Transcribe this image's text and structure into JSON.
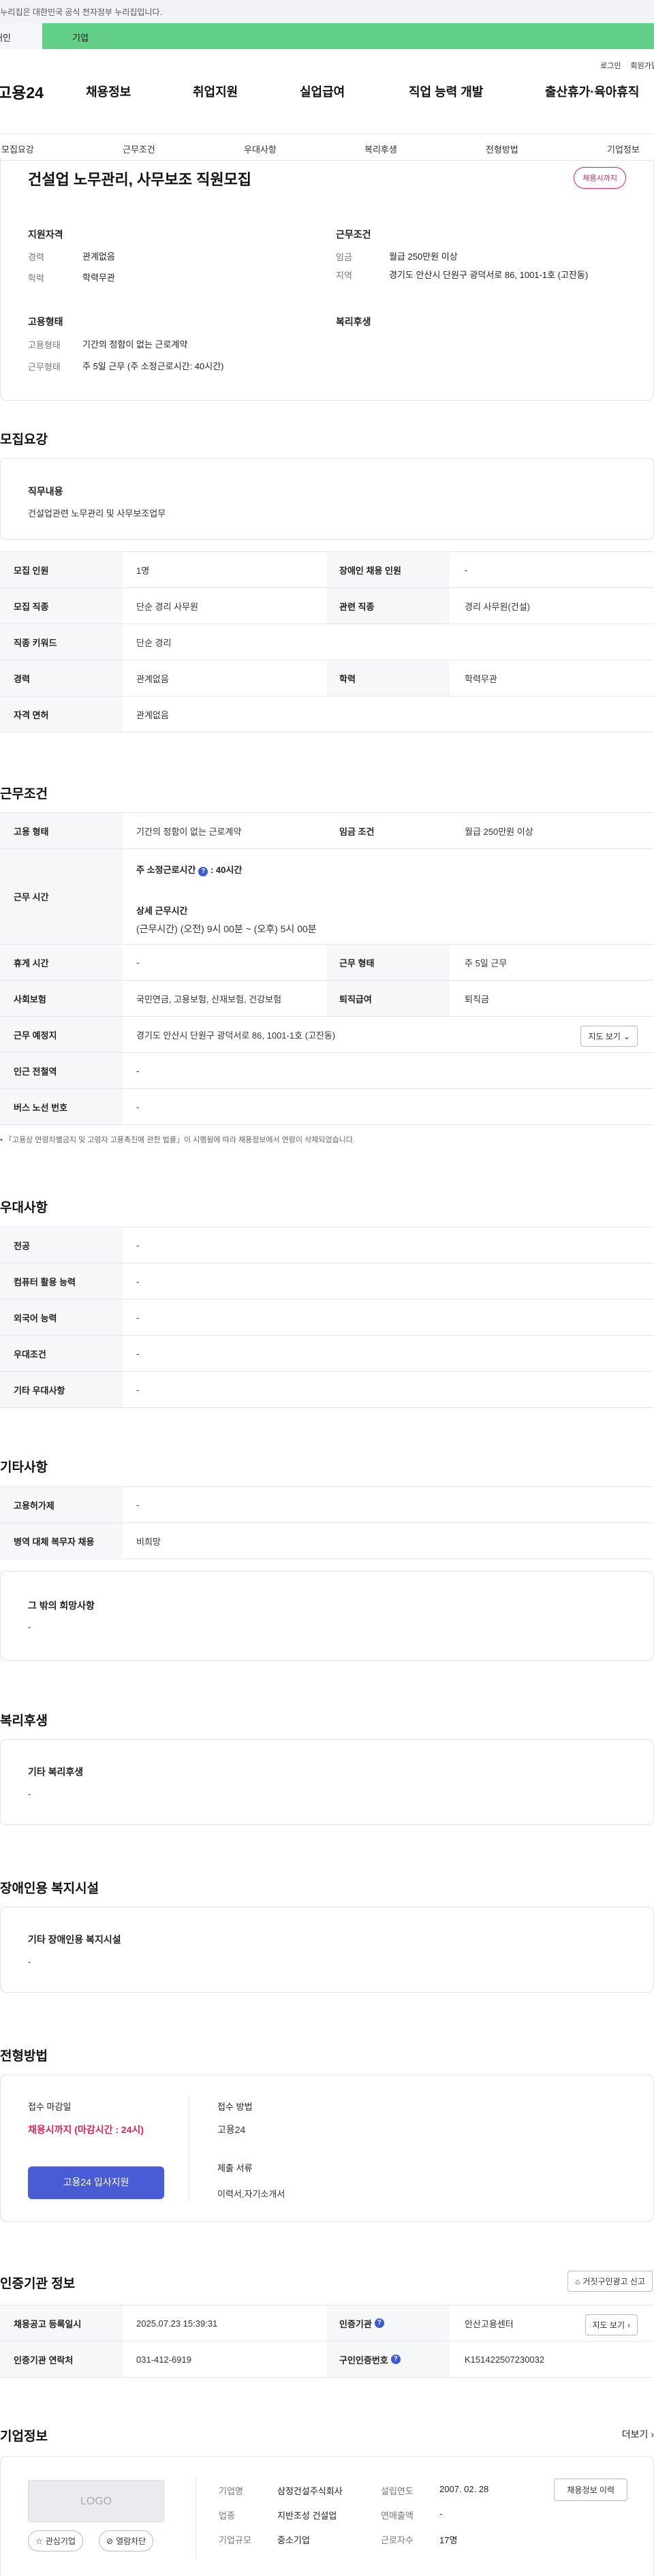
{
  "gov_banner": "이 누리집은 대한민국 공식 전자정부 누리집입니다.",
  "usertype": {
    "personal": "개인",
    "company": "기업"
  },
  "util": {
    "login": "로그인",
    "signup": "회원가입"
  },
  "gnb": {
    "logo": "고용24",
    "menus": [
      "채용정보",
      "취업지원",
      "실업급여",
      "직업 능력 개발",
      "출산휴가·육아휴직"
    ]
  },
  "lnb": [
    "모집요강",
    "근무조건",
    "우대사항",
    "복리후생",
    "전형방법",
    "기업정보"
  ],
  "job": {
    "title": "건설업 노무관리, 사무보조 직원모집",
    "badge": "채용시까지",
    "support_h": "지원자격",
    "career_k": "경력",
    "career_v": "관계없음",
    "edu_k": "학력",
    "edu_v": "학력무관",
    "cond_h": "근무조건",
    "wage_k": "임금",
    "wage_v": "월급 250만원 이상",
    "region_k": "지역",
    "region_v": "경기도 안산시 단원구 광덕서로 86, 1001-1호 (고잔동)",
    "emp_h": "고용형태",
    "emp_k": "고용형태",
    "emp_v": "기간의 정함이 없는 근로계약",
    "work_k": "근무형태",
    "work_v": "주 5일 근무 (주 소정근로시간: 40시간)",
    "welfare_h": "복리후생"
  },
  "recruit": {
    "title": "모집요강",
    "duty_h": "직무내용",
    "duty_v": "건설업관련 노무관리 및  사무보조업무",
    "rows": [
      {
        "k": "모집 인원",
        "v": "1명",
        "k2": "장애인 채용 인원",
        "v2": "-"
      },
      {
        "k": "모집 직종",
        "v": "단순 경리 사무원",
        "k2": "관련 직종",
        "v2": "경리 사무원(건설)"
      },
      {
        "k": "직종 키워드",
        "v": "단순 경리"
      },
      {
        "k": "경력",
        "v": "관계없음",
        "k2": "학력",
        "v2": "학력무관"
      },
      {
        "k": "자격 면허",
        "v": "관계없음"
      }
    ]
  },
  "workcond": {
    "title": "근무조건",
    "r1": {
      "k": "고용 형태",
      "v": "기간의 정함이 없는 근로계약",
      "k2": "임금 조건",
      "v2": "월급 250만원 이상"
    },
    "hours": {
      "k": "근무 시간",
      "weekly_label": "주 소정근로시간",
      "weekly_value": ": 40시간",
      "detail_label": "상세 근무시간",
      "detail_value": "(근무시간) (오전) 9시 00분 ~ (오후) 5시 00분"
    },
    "r3": {
      "k": "휴게 시간",
      "v": "-",
      "k2": "근무 형태",
      "v2": "주 5일 근무"
    },
    "r4": {
      "k": "사회보험",
      "v": "국민연금, 고용보험, 산재보험, 건강보험",
      "k2": "퇴직급여",
      "v2": "퇴직금"
    },
    "r5": {
      "k": "근무 예정지",
      "v": "경기도 안산시 단원구 광덕서로 86, 1001-1호 (고잔동)",
      "btn": "지도 보기"
    },
    "r6": {
      "k": "인근 전철역",
      "v": "-"
    },
    "r7": {
      "k": "버스 노선 번호",
      "v": "-"
    },
    "note": "「고용상 연령차별금지 및 고령자 고용촉진에 관한 법률」이 시행됨에 따라 채용정보에서 연령이 삭제되었습니다."
  },
  "pref": {
    "title": "우대사항",
    "rows": [
      {
        "k": "전공",
        "v": "-"
      },
      {
        "k": "컴퓨터 활용 능력",
        "v": "-"
      },
      {
        "k": "외국어 능력",
        "v": "-"
      },
      {
        "k": "우대조건",
        "v": "-"
      },
      {
        "k": "기타 우대사항",
        "v": "-"
      }
    ]
  },
  "etc": {
    "title": "기타사항",
    "rows": [
      {
        "k": "고용허가제",
        "v": "-"
      },
      {
        "k": "병역 대체 복무자 채용",
        "v": "비희망"
      }
    ],
    "hope_h": "그 밖의 희망사항",
    "hope_v": "-"
  },
  "welfare": {
    "title": "복리후생",
    "h": "기타 복리후생",
    "v": "-"
  },
  "disabled": {
    "title": "장애인용 복지시설",
    "h": "기타 장애인용 복지시설",
    "v": "-"
  },
  "selection": {
    "title": "전형방법",
    "deadline_h": "접수 마감일",
    "deadline_v": "채용시까지 (마감시간 : 24시)",
    "apply_btn": "고용24 입사지원",
    "method_h": "접수 방법",
    "method_v": "고용24",
    "docs_h": "제출 서류",
    "docs_v": "이력서,자기소개서"
  },
  "cert": {
    "title": "인증기관 정보",
    "report_btn": "거짓구인광고 신고",
    "r1": {
      "k": "채용공고 등록일시",
      "v": "2025.07.23 15:39:31",
      "k2": "인증기관",
      "v2": "안산고용센터",
      "btn": "지도 보기"
    },
    "r2": {
      "k": "인증기관 연락처",
      "v": "031-412-6919",
      "k2": "구인인증번호",
      "v2": "K151422507230032"
    }
  },
  "company": {
    "title": "기업정보",
    "more": "더보기",
    "logo": "LOGO",
    "fav_btn": "관심기업",
    "block_btn": "열람차단",
    "name_k": "기업명",
    "name_v": "삼정건설주식회사",
    "year_k": "설립연도",
    "year_v": "2007. 02. 28",
    "ind_k": "업종",
    "ind_v": "지반조성 건설업",
    "sales_k": "연매출액",
    "sales_v": "-",
    "size_k": "기업규모",
    "size_v": "중소기업",
    "emp_k": "근로자수",
    "emp_v": "17명",
    "history_btn": "채용정보 이력"
  }
}
